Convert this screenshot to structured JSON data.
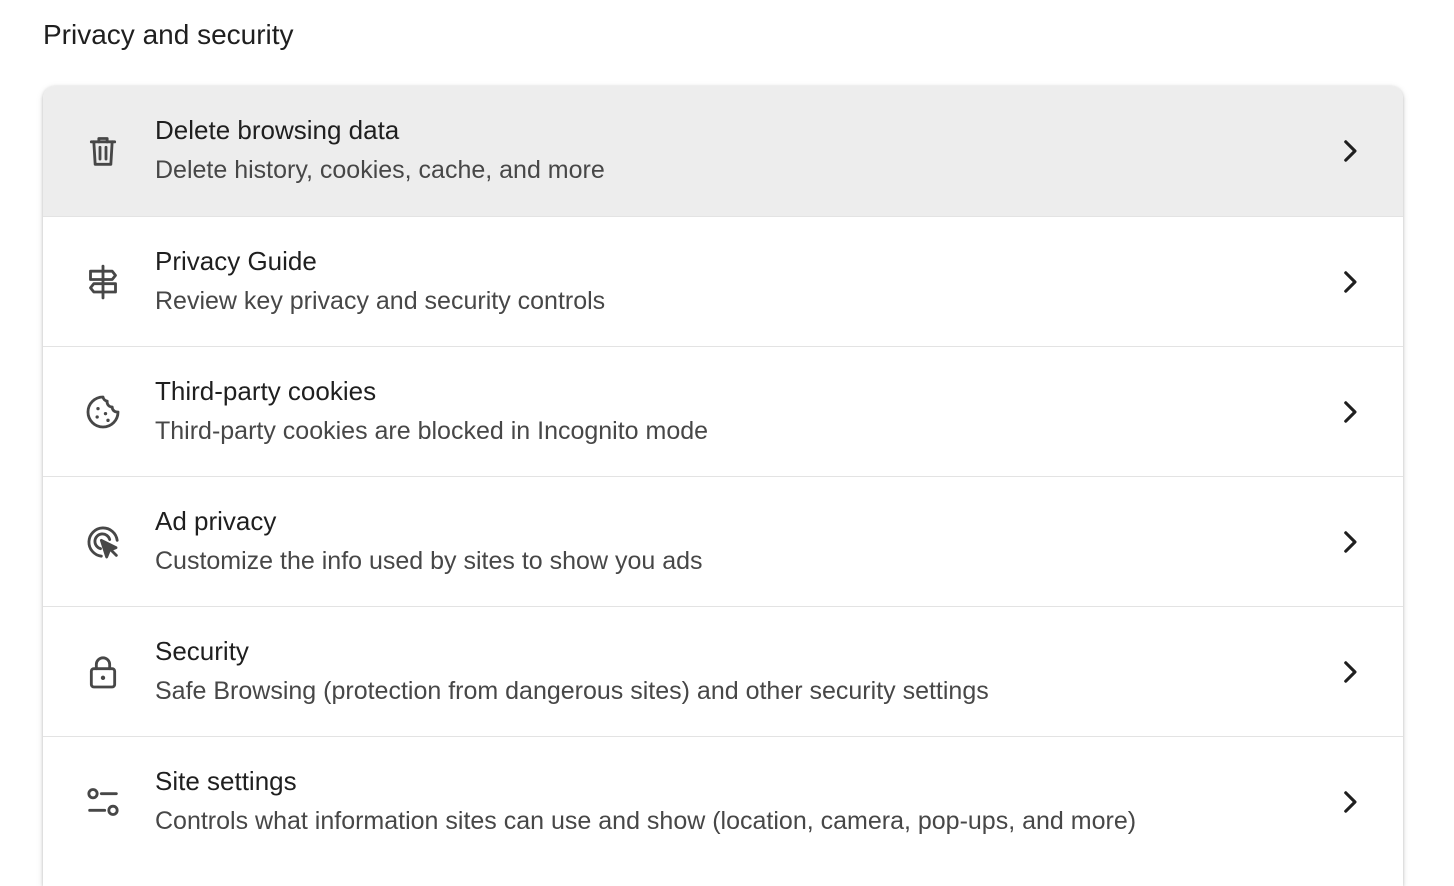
{
  "section": {
    "title": "Privacy and security"
  },
  "colors": {
    "hover_row": "#ededed",
    "text_primary": "#1f1f1f",
    "text_secondary": "#474747",
    "divider": "#e3e3e3"
  },
  "items": [
    {
      "title": "Delete browsing data",
      "subtitle": "Delete history, cookies, cache, and more",
      "icon": "trash-icon",
      "hovered": true
    },
    {
      "title": "Privacy Guide",
      "subtitle": "Review key privacy and security controls",
      "icon": "signpost-icon"
    },
    {
      "title": "Third-party cookies",
      "subtitle": "Third-party cookies are blocked in Incognito mode",
      "icon": "cookie-icon"
    },
    {
      "title": "Ad privacy",
      "subtitle": "Customize the info used by sites to show you ads",
      "icon": "ad-target-icon"
    },
    {
      "title": "Security",
      "subtitle": "Safe Browsing (protection from dangerous sites) and other security settings",
      "icon": "lock-icon"
    },
    {
      "title": "Site settings",
      "subtitle": "Controls what information sites can use and show (location, camera, pop-ups, and more)",
      "icon": "tune-icon"
    }
  ]
}
